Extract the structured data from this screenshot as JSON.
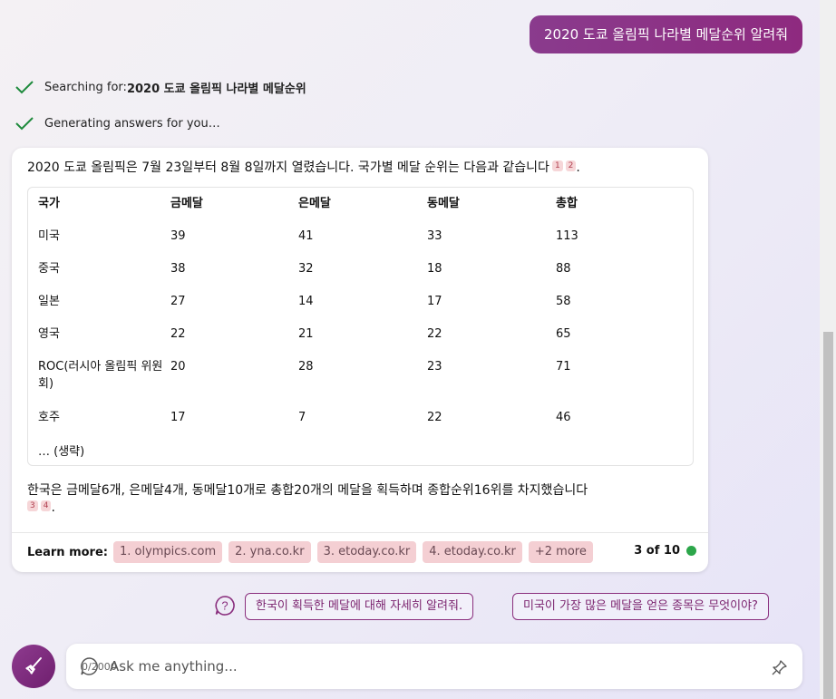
{
  "user_message": "2020 도쿄 올림픽 나라별 메달순위 알려줘",
  "status": {
    "searching_prefix": "Searching for: ",
    "searching_query": "2020 도쿄 올림픽 나라별 메달순위",
    "generating": "Generating answers for you…"
  },
  "answer": {
    "intro": "2020 도쿄 올림픽은 7월 23일부터 8월 8일까지 열렸습니다. 국가별 메달 순위는 다음과 같습니다",
    "intro_refs": [
      "1",
      "2"
    ],
    "table": {
      "headers": [
        "국가",
        "금메달",
        "은메달",
        "동메달",
        "총합"
      ],
      "rows": [
        [
          "미국",
          "39",
          "41",
          "33",
          "113"
        ],
        [
          "중국",
          "38",
          "32",
          "18",
          "88"
        ],
        [
          "일본",
          "27",
          "14",
          "17",
          "58"
        ],
        [
          "영국",
          "22",
          "21",
          "22",
          "65"
        ],
        [
          "ROC(러시아 올림픽 위원회)",
          "20",
          "28",
          "23",
          "71"
        ],
        [
          "호주",
          "17",
          "7",
          "22",
          "46"
        ]
      ],
      "more": "… (생략)"
    },
    "korea_text": "한국은 금메달6개, 은메달4개, 동메달10개로 총합20개의 메달을 획득하며 종합순위16위를 차지했습니다",
    "korea_refs": [
      "3",
      "4"
    ],
    "learn_more_label": "Learn more:",
    "sources": [
      "1. olympics.com",
      "2. yna.co.kr",
      "3. etoday.co.kr",
      "4. etoday.co.kr",
      "+2 more"
    ],
    "turn_count": "3 of 10",
    "status_color": "#2ca64a"
  },
  "suggestions": [
    "한국이 획득한 메달에 대해 자세히 알려줘.",
    "미국이 가장 많은 메달을 얻은 종목은 무엇이야?"
  ],
  "input": {
    "placeholder": "Ask me anything...",
    "char_count": "0/2000"
  },
  "colors": {
    "accent": "#8a2f7e",
    "chip_bg": "#f4cfd3"
  }
}
